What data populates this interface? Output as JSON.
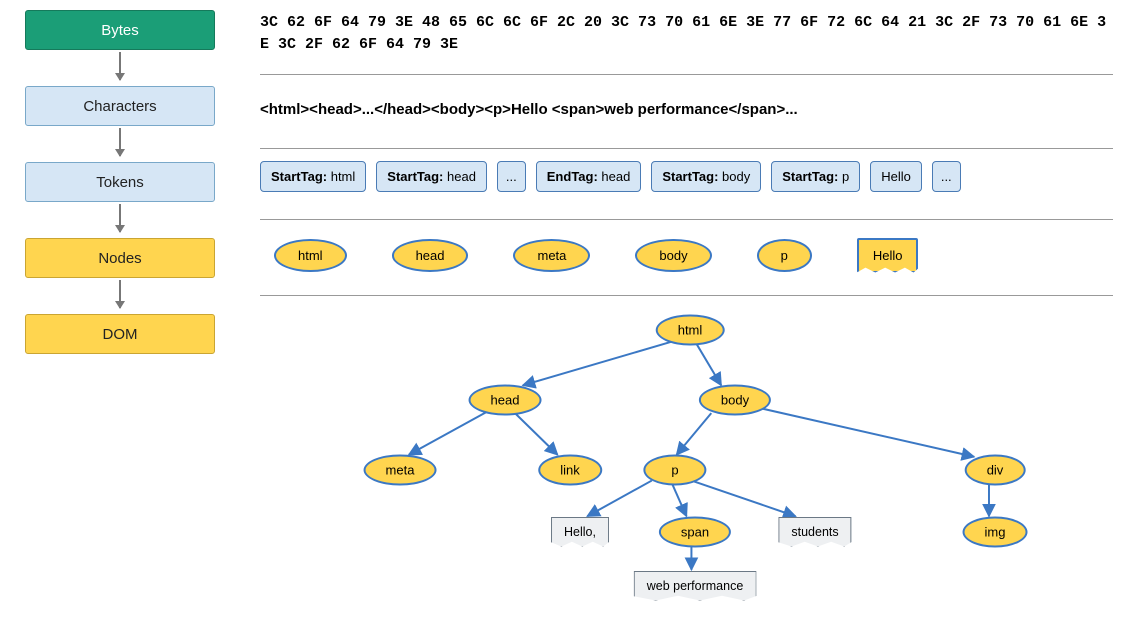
{
  "stages": {
    "bytes": "Bytes",
    "characters": "Characters",
    "tokens": "Tokens",
    "nodes": "Nodes",
    "dom": "DOM"
  },
  "bytes_hex": "3C 62 6F 64 79 3E 48 65 6C 6C 6F 2C 20 3C 73 70 61 6E 3E 77 6F 72 6C 64 21 3C 2F 73 70 61 6E 3E 3C 2F 62 6F 64 79 3E",
  "characters_string": "<html><head>...</head><body><p>Hello <span>web performance</span>...",
  "tokens": [
    {
      "label": "StartTag:",
      "value": "html"
    },
    {
      "label": "StartTag:",
      "value": "head"
    },
    {
      "label": "",
      "value": "..."
    },
    {
      "label": "EndTag:",
      "value": "head"
    },
    {
      "label": "StartTag:",
      "value": "body"
    },
    {
      "label": "StartTag:",
      "value": "p"
    },
    {
      "label": "",
      "value": "Hello"
    },
    {
      "label": "",
      "value": "..."
    }
  ],
  "node_list": [
    "html",
    "head",
    "meta",
    "body",
    "p"
  ],
  "node_text_chip": "Hello",
  "dom_tree": {
    "html": "html",
    "head": "head",
    "body": "body",
    "meta": "meta",
    "link": "link",
    "p": "p",
    "div": "div",
    "span": "span",
    "img": "img",
    "hello": "Hello,",
    "students": "students",
    "webperf": "web performance"
  }
}
